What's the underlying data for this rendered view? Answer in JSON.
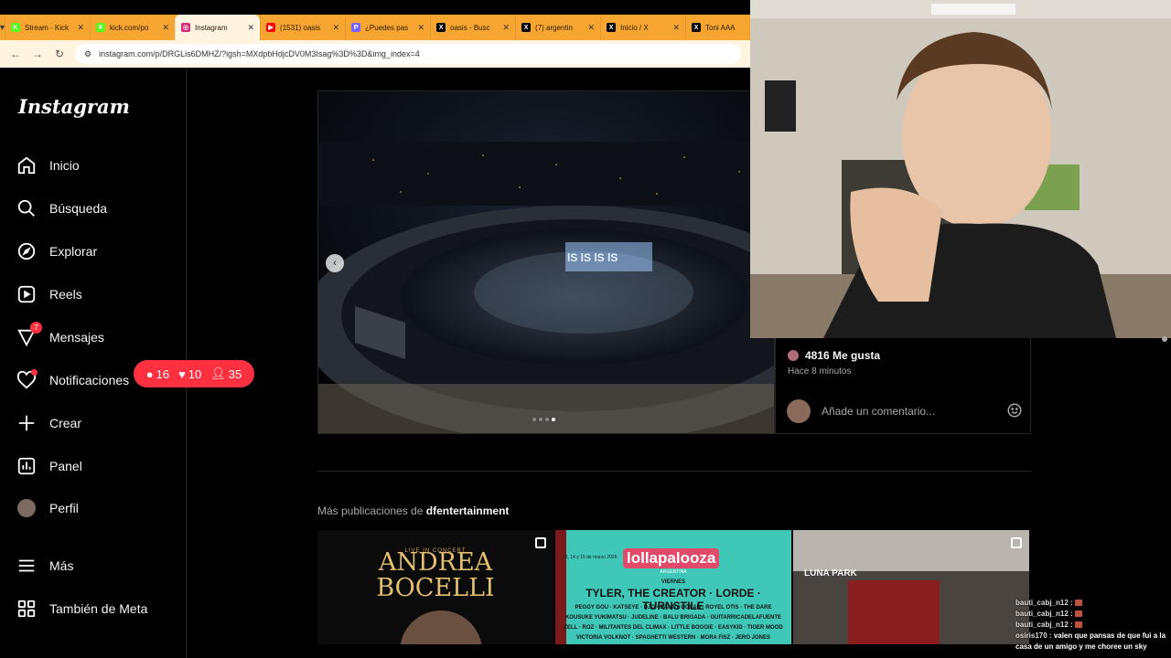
{
  "browser": {
    "tabs": [
      {
        "title": "Stream - Kick",
        "fav_color": "#53fc18",
        "fav_glyph": "K",
        "active": false
      },
      {
        "title": "kick.com/po",
        "fav_color": "#53fc18",
        "fav_glyph": "K",
        "active": false
      },
      {
        "title": "Instagram",
        "fav_color": "#d62976",
        "fav_glyph": "◎",
        "active": true
      },
      {
        "title": "(1531) oasis",
        "fav_color": "#ff0000",
        "fav_glyph": "▶",
        "active": false
      },
      {
        "title": "¿Puedes pas",
        "fav_color": "#7b61ff",
        "fav_glyph": "P",
        "active": false
      },
      {
        "title": "oasis - Busc",
        "fav_color": "#000000",
        "fav_glyph": "X",
        "active": false
      },
      {
        "title": "(7) argentin",
        "fav_color": "#000000",
        "fav_glyph": "X",
        "active": false
      },
      {
        "title": "Inicio / X",
        "fav_color": "#000000",
        "fav_glyph": "X",
        "active": false
      },
      {
        "title": "Toni AAA",
        "fav_color": "#000000",
        "fav_glyph": "X",
        "active": false
      }
    ],
    "url": "instagram.com/p/DRGLis6DMHZ/?igsh=MXdpbHdjcDV0M3Isag%3D%3D&img_index=4"
  },
  "sidebar": {
    "logo": "Instagram",
    "items": [
      {
        "label": "Inicio",
        "icon": "home-icon"
      },
      {
        "label": "Búsqueda",
        "icon": "search-icon"
      },
      {
        "label": "Explorar",
        "icon": "compass-icon"
      },
      {
        "label": "Reels",
        "icon": "reels-icon"
      },
      {
        "label": "Mensajes",
        "icon": "messenger-icon",
        "badge": "7"
      },
      {
        "label": "Notificaciones",
        "icon": "heart-icon"
      },
      {
        "label": "Crear",
        "icon": "plus-icon"
      },
      {
        "label": "Panel",
        "icon": "chart-icon"
      },
      {
        "label": "Perfil",
        "icon": "avatar"
      },
      {
        "label": "Más",
        "icon": "menu-icon"
      },
      {
        "label": "También de Meta",
        "icon": "meta-grid-icon"
      }
    ],
    "notifications_pill": {
      "comments": "16",
      "likes": "10",
      "follows": "35"
    }
  },
  "post": {
    "likes": "4816 Me gusta",
    "time": "Hace 8 minutos",
    "comment_placeholder": "Añade un comentario...",
    "carousel": {
      "total": 4,
      "current": 4
    }
  },
  "more": {
    "prefix": "Más publicaciones de",
    "account": "dfentertainment",
    "thumbs": [
      {
        "title": "ANDREA BOCELLI",
        "subtitle": "LIVE IN CONCERT"
      },
      {
        "title": "lollapalooza",
        "subtitle": "ARGENTINA",
        "date": "13, 14 y 15 de marzo 2026",
        "day": "VIERNES",
        "headliners": "TYLER, THE CREATOR · LORDE · TURNSTILE",
        "lineup1": "PEGGY GOU · KATSEYE · DJO · DANNY OCEAN · ROYEL OTIS · THE DARE",
        "lineup2": "KOUSUKE YUKIMATSU · JUDELINE · BALU BRIGADA · GUITARRICADELAFUENTE",
        "lineup3": "ZELL · ROZ · MILITANTES DEL CLIMAX · LITTLE BOOGIE · EASYKID · TIGER MOOD",
        "lineup4": "VICTORIA VOLKNOT · SPAGHETTI WESTERN · MORA FISZ · JERO JONES"
      },
      {
        "title": "LUNA PARK"
      }
    ]
  },
  "chat": [
    {
      "user": "bauti_cabj_n12 :",
      "msg": ""
    },
    {
      "user": "bauti_cabj_n12 :",
      "msg": ""
    },
    {
      "user": "bauti_cabj_n12 :",
      "msg": ""
    },
    {
      "user": "osiris170 :",
      "msg": "valen que pansas de que fui a la casa de un amigo y me choree un sky"
    }
  ]
}
